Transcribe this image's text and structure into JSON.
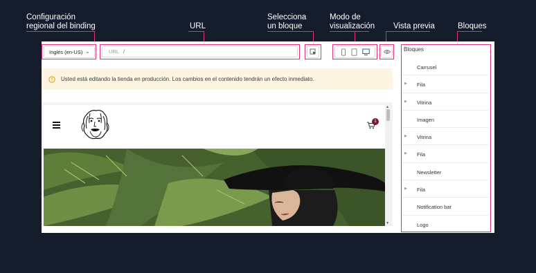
{
  "callouts": {
    "locale": "Configuración\nregional del binding",
    "url": "URL",
    "select_block": "Selecciona\nun bloque",
    "view_mode": "Modo de\nvisualización",
    "preview": "Vista previa",
    "blocks": "Bloques"
  },
  "toolbar": {
    "locale_value": "Inglés (en-US)",
    "url_prefix": "URL",
    "url_value": "/",
    "view_modes": [
      "mobile-icon",
      "tablet-icon",
      "desktop-icon"
    ],
    "active_view_mode": "desktop"
  },
  "warning": {
    "text": "Usted está editando la tienda en producción. Los cambios en el contenido tendrán un efecto inmediato."
  },
  "store": {
    "cart_count": "1"
  },
  "blocks_panel": {
    "title": "Bloques",
    "items": [
      {
        "label": "Carrusel",
        "expandable": false
      },
      {
        "label": "Fila",
        "expandable": true
      },
      {
        "label": "Vitrina",
        "expandable": true
      },
      {
        "label": "Imagen",
        "expandable": false
      },
      {
        "label": "Vitrina",
        "expandable": true
      },
      {
        "label": "Fila",
        "expandable": true
      },
      {
        "label": "Newsletter",
        "expandable": false
      },
      {
        "label": "Fila",
        "expandable": true
      },
      {
        "label": "Notification bar",
        "expandable": false
      },
      {
        "label": "Logo",
        "expandable": false
      }
    ]
  },
  "colors": {
    "background": "#151c2c",
    "callout_line": "#e0307a",
    "warning_bg": "#fdf5e2",
    "warning_icon": "#e3a008",
    "active_view": "#1a5fb4",
    "cart_badge": "#7a1a2e"
  }
}
